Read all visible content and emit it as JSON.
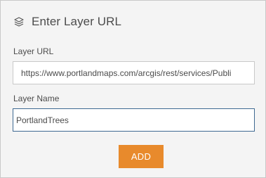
{
  "header": {
    "icon": "layers-icon",
    "title": "Enter Layer URL"
  },
  "form": {
    "url_label": "Layer URL",
    "url_value": "https://www.portlandmaps.com/arcgis/rest/services/Publi",
    "name_label": "Layer Name",
    "name_value": "PortlandTrees"
  },
  "actions": {
    "add_label": "ADD"
  },
  "colors": {
    "accent": "#e88a2c",
    "focus_border": "#3e6991",
    "text": "#4c4c4c",
    "panel_bg": "#f4f4f4"
  }
}
